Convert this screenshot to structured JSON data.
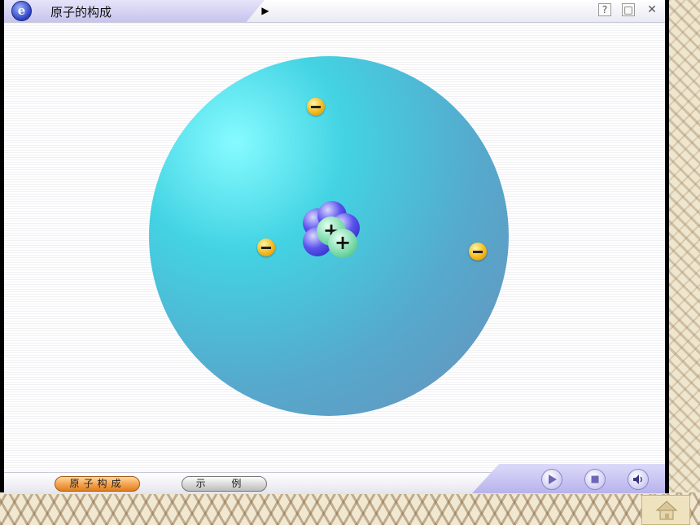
{
  "window": {
    "title": "原子的构成",
    "logo_letter": "e",
    "help_label": "?",
    "restore_label": "□",
    "close_label": "✕",
    "nav_arrow": "▶"
  },
  "atom": {
    "electrons": 3,
    "protons": 2,
    "neutrons": 4,
    "proton_symbol": "+"
  },
  "bottom": {
    "tabs": [
      {
        "label": "原子构成",
        "active": true
      },
      {
        "label": "示 例",
        "active": false
      }
    ]
  },
  "controls": {
    "buttons": [
      "play-icon",
      "stop-icon",
      "speaker-icon"
    ]
  },
  "colors": {
    "sphere_highlight": "#86fbff",
    "sphere_shadow": "#6a8fbb",
    "electron": "#f2b91c",
    "neutron": "#5a53ee",
    "proton": "#84dfb1",
    "active_tab": "#f3a24c"
  }
}
